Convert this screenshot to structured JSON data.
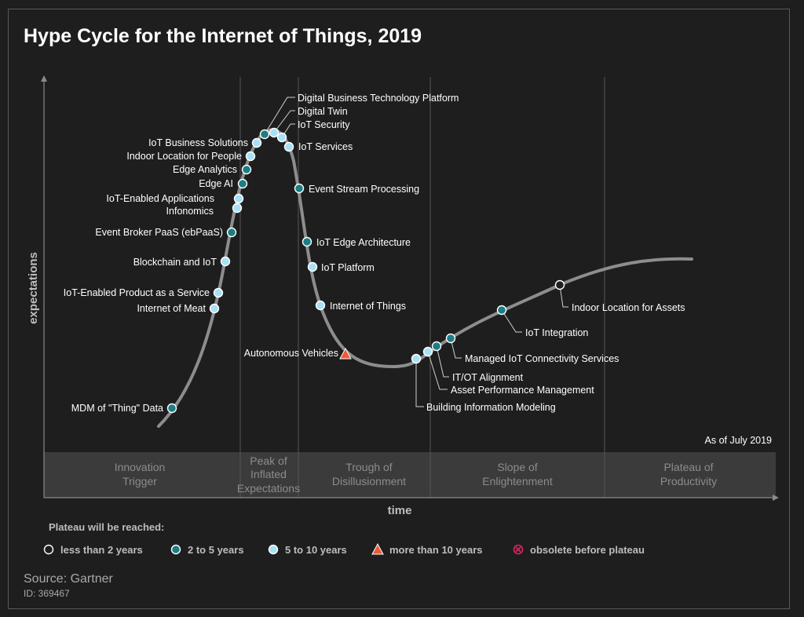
{
  "chart_data": {
    "type": "scatter",
    "title": "Hype Cycle for the Internet of Things, 2019",
    "xlabel": "time",
    "ylabel": "expectations",
    "as_of": "As of July 2019",
    "phases": [
      "Innovation Trigger",
      "Peak of Inflated Expectations",
      "Trough of Disillusionment",
      "Slope of Enlightenment",
      "Plateau of Productivity"
    ],
    "legend_title": "Plateau will be reached:",
    "legend": [
      {
        "key": "lt2",
        "label": "less than 2 years",
        "marker": "circle",
        "color": "#1e1e1e"
      },
      {
        "key": "2to5",
        "label": "2 to 5 years",
        "marker": "circle",
        "color": "#1c7e84"
      },
      {
        "key": "5to10",
        "label": "5 to 10 years",
        "marker": "circle",
        "color": "#a8e0f6"
      },
      {
        "key": "gt10",
        "label": "more than 10 years",
        "marker": "triangle",
        "color": "#ef5a34"
      },
      {
        "key": "obsolete",
        "label": "obsolete before plateau",
        "marker": "cross-circle",
        "color": "#e0245e"
      }
    ],
    "points": [
      {
        "label": "MDM of \"Thing\" Data",
        "category": "2to5"
      },
      {
        "label": "Internet of Meat",
        "category": "5to10"
      },
      {
        "label": "IoT-Enabled Product as a Service",
        "category": "5to10"
      },
      {
        "label": "Blockchain and IoT",
        "category": "5to10"
      },
      {
        "label": "Event Broker PaaS (ebPaaS)",
        "category": "2to5"
      },
      {
        "label": "Infonomics",
        "category": "5to10"
      },
      {
        "label": "IoT-Enabled Applications",
        "category": "5to10"
      },
      {
        "label": "Edge AI",
        "category": "2to5"
      },
      {
        "label": "Edge Analytics",
        "category": "2to5"
      },
      {
        "label": "Indoor Location for People",
        "category": "5to10"
      },
      {
        "label": "IoT Business Solutions",
        "category": "5to10"
      },
      {
        "label": "Digital Business Technology Platform",
        "category": "2to5"
      },
      {
        "label": "Digital Twin",
        "category": "5to10"
      },
      {
        "label": "IoT Security",
        "category": "5to10"
      },
      {
        "label": "IoT Services",
        "category": "5to10"
      },
      {
        "label": "Event Stream Processing",
        "category": "2to5"
      },
      {
        "label": "IoT Edge Architecture",
        "category": "2to5"
      },
      {
        "label": "IoT Platform",
        "category": "5to10"
      },
      {
        "label": "Internet of Things",
        "category": "5to10"
      },
      {
        "label": "Autonomous Vehicles",
        "category": "gt10"
      },
      {
        "label": "Building Information Modeling",
        "category": "5to10"
      },
      {
        "label": "Asset Performance Management",
        "category": "5to10"
      },
      {
        "label": "IT/OT Alignment",
        "category": "2to5"
      },
      {
        "label": "Managed IoT Connectivity Services",
        "category": "2to5"
      },
      {
        "label": "IoT Integration",
        "category": "2to5"
      },
      {
        "label": "Indoor Location for Assets",
        "category": "lt2"
      }
    ]
  },
  "source": "Source: Gartner",
  "source_id": "ID: 369467"
}
